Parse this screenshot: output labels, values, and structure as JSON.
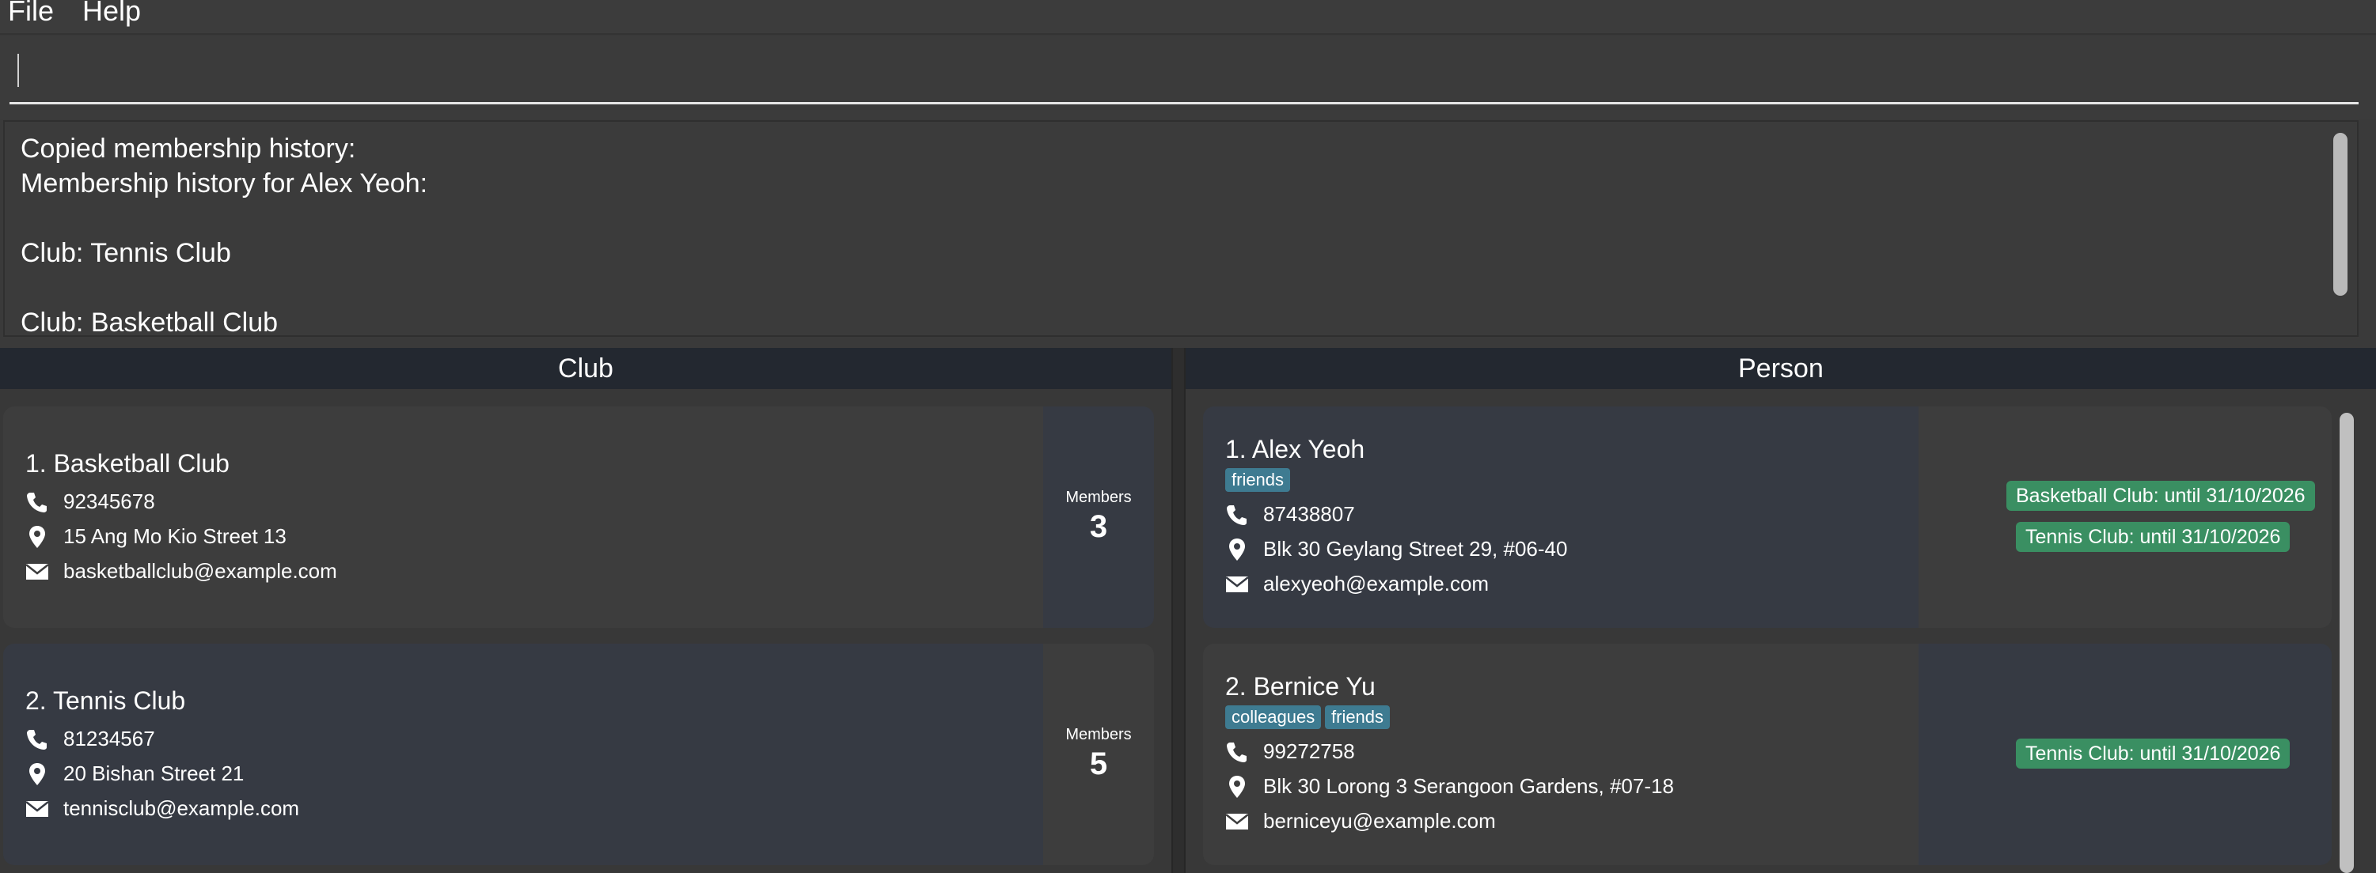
{
  "menu": {
    "file": "File",
    "help": "Help"
  },
  "command": {
    "value": ""
  },
  "result": {
    "lines": [
      "Copied membership history:",
      "Membership history for Alex Yeoh:",
      "",
      "Club: Tennis Club",
      "",
      "Club: Basketball Club"
    ]
  },
  "clubPanel": {
    "header": "Club",
    "clubs": [
      {
        "title": "1. Basketball Club",
        "phone": "92345678",
        "address": "15 Ang Mo Kio Street 13",
        "email": "basketballclub@example.com",
        "membersLabel": "Members",
        "membersCount": "3"
      },
      {
        "title": "2. Tennis Club",
        "phone": "81234567",
        "address": "20 Bishan Street 21",
        "email": "tennisclub@example.com",
        "membersLabel": "Members",
        "membersCount": "5"
      }
    ]
  },
  "personPanel": {
    "header": "Person",
    "persons": [
      {
        "title": "1. Alex Yeoh",
        "tags": [
          "friends"
        ],
        "phone": "87438807",
        "address": "Blk 30 Geylang Street 29, #06-40",
        "email": "alexyeoh@example.com",
        "memberships": [
          "Basketball Club: until 31/10/2026",
          "Tennis Club: until 31/10/2026"
        ]
      },
      {
        "title": "2. Bernice Yu",
        "tags": [
          "colleagues",
          "friends"
        ],
        "phone": "99272758",
        "address": "Blk 30 Lorong 3 Serangoon Gardens, #07-18",
        "email": "berniceyu@example.com",
        "memberships": [
          "Tennis Club: until 31/10/2026"
        ]
      }
    ]
  },
  "colors": {
    "tag": "#3e7b91",
    "membership": "#3a8f62",
    "header": "#232830",
    "cardLight": "#3d3d3d",
    "cardDark": "#363a43"
  }
}
